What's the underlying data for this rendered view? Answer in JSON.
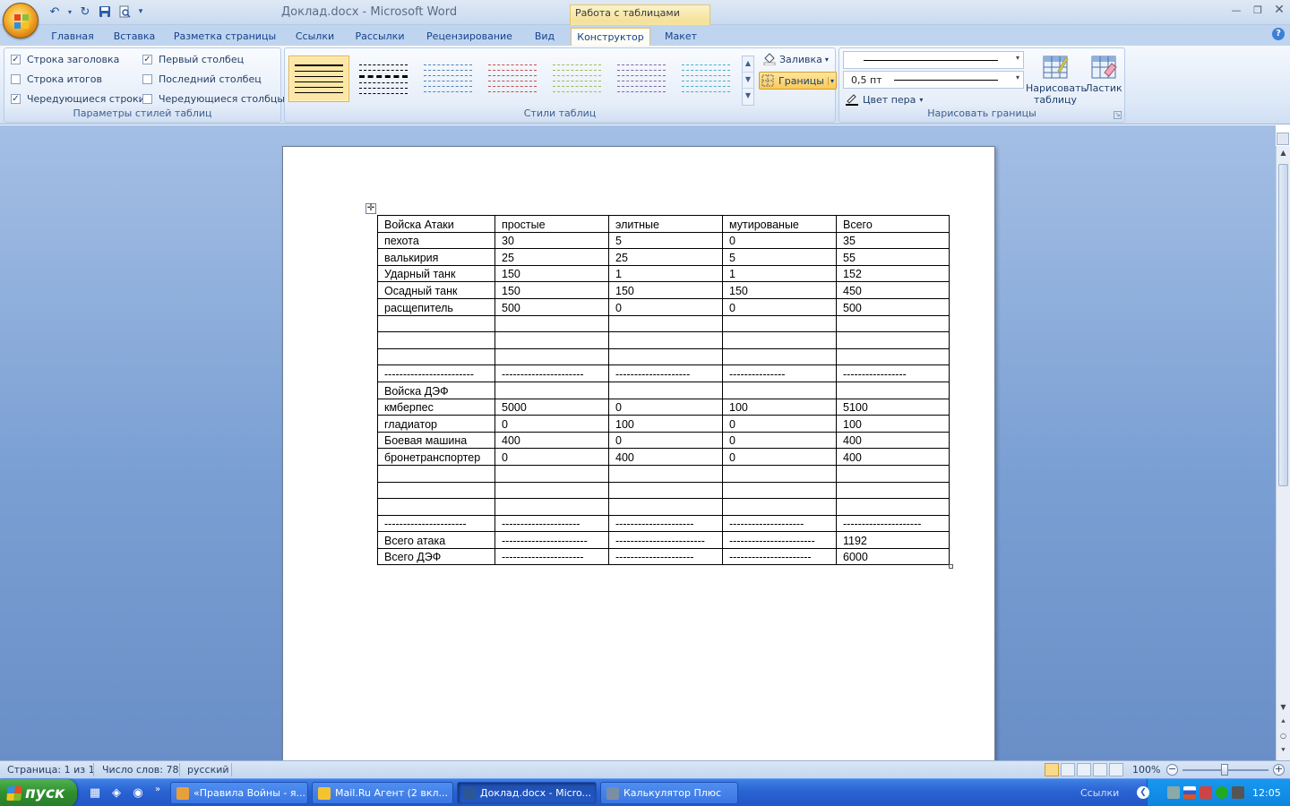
{
  "app": {
    "doc_title": "Доклад.docx - Microsoft Word",
    "context_tab_group": "Работа с таблицами"
  },
  "tabs": [
    "Главная",
    "Вставка",
    "Разметка страницы",
    "Ссылки",
    "Рассылки",
    "Рецензирование",
    "Вид",
    "Конструктор",
    "Макет"
  ],
  "active_tab": "Конструктор",
  "ribbon": {
    "style_options": {
      "label": "Параметры стилей таблиц",
      "options": [
        {
          "label": "Строка заголовка",
          "checked": true
        },
        {
          "label": "Строка итогов",
          "checked": false
        },
        {
          "label": "Чередующиеся строки",
          "checked": true
        },
        {
          "label": "Первый столбец",
          "checked": true
        },
        {
          "label": "Последний столбец",
          "checked": false
        },
        {
          "label": "Чередующиеся столбцы",
          "checked": false
        }
      ]
    },
    "table_styles": {
      "label": "Стили таблиц",
      "swatch_colors": [
        "#000000",
        "#000000",
        "#4f81bd",
        "#c0504d",
        "#9bbb59",
        "#8064a2",
        "#4bacc6"
      ],
      "shading_label": "Заливка",
      "borders_label": "Границы"
    },
    "draw_borders": {
      "label": "Нарисовать границы",
      "line_weight": "0,5 пт",
      "pen_color_label": "Цвет пера",
      "draw_table_label": "Нарисовать таблицу",
      "draw_table_line1": "Нарисовать",
      "draw_table_line2": "таблицу",
      "eraser_label": "Ластик"
    }
  },
  "document": {
    "table": [
      [
        "Войска Атаки",
        "простые",
        "элитные",
        "мутированые",
        "Всего"
      ],
      [
        "пехота",
        "30",
        "5",
        "0",
        "35"
      ],
      [
        "валькирия",
        "25",
        "25",
        "5",
        "55"
      ],
      [
        "Ударный танк",
        "150",
        "1",
        "1",
        "152"
      ],
      [
        "Осадный танк",
        "150",
        "150",
        "150",
        "450"
      ],
      [
        "расщепитель",
        "500",
        "0",
        "0",
        "500"
      ],
      [
        "",
        "",
        "",
        "",
        ""
      ],
      [
        "",
        "",
        "",
        "",
        ""
      ],
      [
        "",
        "",
        "",
        "",
        ""
      ],
      [
        "------------------------",
        "----------------------",
        "--------------------",
        "---------------",
        "-----------------"
      ],
      [
        "Войска ДЭФ",
        "",
        "",
        "",
        ""
      ],
      [
        "кмберпес",
        "5000",
        "0",
        "100",
        "5100"
      ],
      [
        "гладиатор",
        "0",
        "100",
        "0",
        "100"
      ],
      [
        "Боевая машина",
        "400",
        "0",
        "0",
        "400"
      ],
      [
        "бронетранспортер",
        "0",
        "400",
        "0",
        "400"
      ],
      [
        "",
        "",
        "",
        "",
        ""
      ],
      [
        "",
        "",
        "",
        "",
        ""
      ],
      [
        "",
        "",
        "",
        "",
        ""
      ],
      [
        "----------------------",
        "---------------------",
        "---------------------",
        "--------------------",
        "---------------------"
      ],
      [
        "Всего атака",
        "-----------------------",
        "------------------------",
        "-----------------------",
        "1192"
      ],
      [
        "Всего ДЭФ",
        "----------------------",
        "---------------------",
        "----------------------",
        "6000"
      ]
    ]
  },
  "statusbar": {
    "page": "Страница: 1 из 1",
    "words": "Число слов: 78",
    "language": "русский",
    "zoom": "100%"
  },
  "taskbar": {
    "start_label": "пуск",
    "tasks": [
      {
        "label": "«Правила Войны - я...",
        "color": "#e8a13a",
        "active": false
      },
      {
        "label": "Mail.Ru Агент (2 вкл...",
        "color": "#f4c430",
        "active": false
      },
      {
        "label": "Доклад.docx - Micro...",
        "color": "#2b5797",
        "active": true
      },
      {
        "label": "Калькулятор Плюс",
        "color": "#7a8ea8",
        "active": false
      }
    ],
    "links_label": "Ссылки",
    "clock": "12:05"
  }
}
